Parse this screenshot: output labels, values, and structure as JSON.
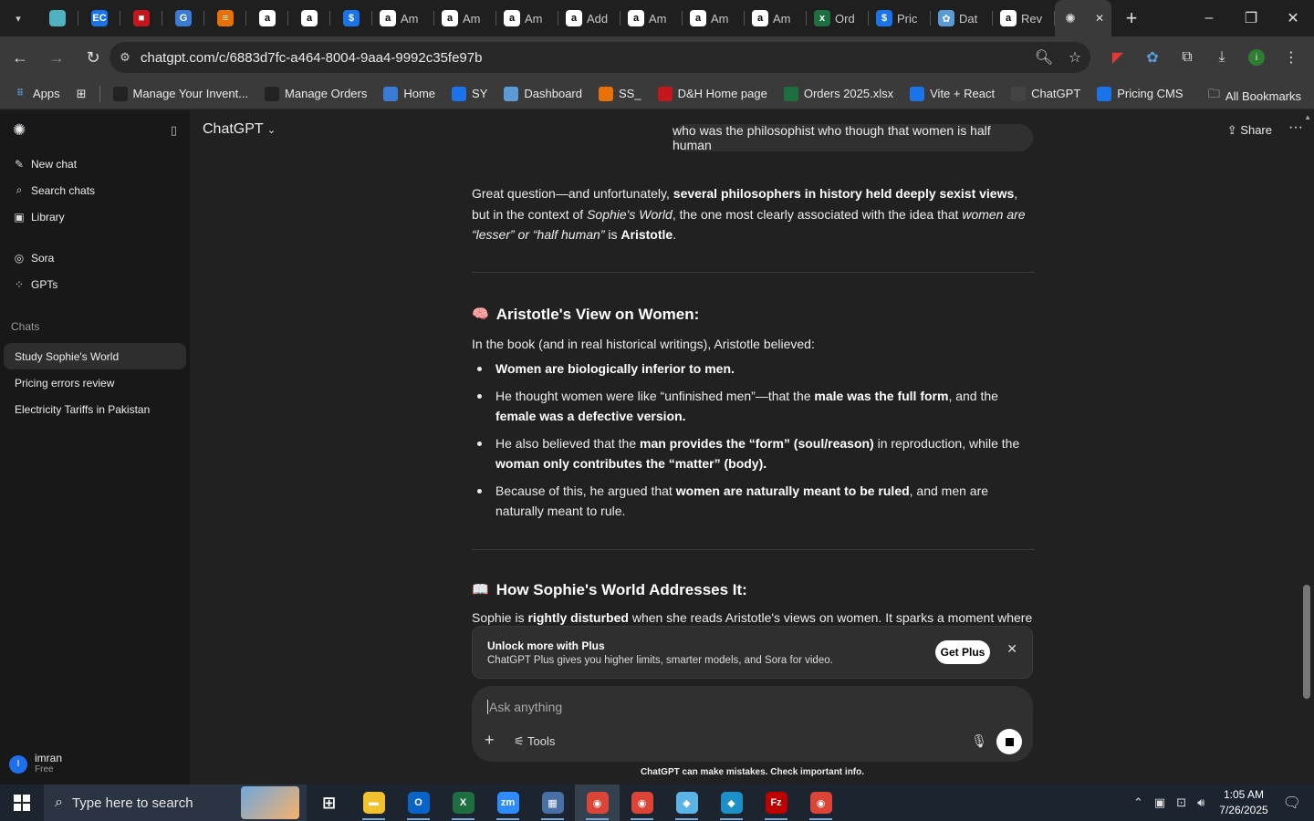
{
  "browser": {
    "tabs": [
      {
        "title": "",
        "icon": "teal-logo-icon",
        "color": "#4fb3bf"
      },
      {
        "title": "",
        "icon": "ec-logo-icon",
        "color": "#1a73e8",
        "glyph": "EC"
      },
      {
        "title": "",
        "icon": "red-app-icon",
        "color": "#c4161c",
        "glyph": "■"
      },
      {
        "title": "",
        "icon": "blue-g-icon",
        "color": "#3a7bd5",
        "glyph": "G"
      },
      {
        "title": "",
        "icon": "orange-stack-icon",
        "color": "#e8710a",
        "glyph": "≡"
      },
      {
        "title": "",
        "icon": "amazon-icon",
        "color": "#ffffff",
        "glyph": "a"
      },
      {
        "title": "",
        "icon": "amazon-icon",
        "color": "#ffffff",
        "glyph": "a"
      },
      {
        "title": "",
        "icon": "dollar-icon",
        "color": "#1a73e8",
        "glyph": "$"
      },
      {
        "title": "Am",
        "icon": "amazon-icon",
        "color": "#ffffff",
        "glyph": "a"
      },
      {
        "title": "Am",
        "icon": "amazon-icon",
        "color": "#ffffff",
        "glyph": "a"
      },
      {
        "title": "Am",
        "icon": "amazon-icon",
        "color": "#ffffff",
        "glyph": "a"
      },
      {
        "title": "Add",
        "icon": "amazon-icon",
        "color": "#ffffff",
        "glyph": "a"
      },
      {
        "title": "Am",
        "icon": "amazon-icon",
        "color": "#ffffff",
        "glyph": "a"
      },
      {
        "title": "Am",
        "icon": "amazon-icon",
        "color": "#ffffff",
        "glyph": "a"
      },
      {
        "title": "Am",
        "icon": "amazon-circle-icon",
        "color": "#ffffff",
        "glyph": "a"
      },
      {
        "title": "Ord",
        "icon": "excel-icon",
        "color": "#1d6f42",
        "glyph": "x"
      },
      {
        "title": "Pric",
        "icon": "dollar-icon",
        "color": "#1a73e8",
        "glyph": "$"
      },
      {
        "title": "Dat",
        "icon": "dashboard-icon",
        "color": "#5b9bd5",
        "glyph": "✿"
      },
      {
        "title": "Rev",
        "icon": "amazon-icon",
        "color": "#ffffff",
        "glyph": "a"
      }
    ],
    "active_tab_icon": "chatgpt-icon",
    "url": "chatgpt.com/c/6883d7fc-a464-8004-9aa4-9992c35fe97b",
    "bookmarks": [
      {
        "label": "Manage Your Invent...",
        "icon": "amazon-icon",
        "color": "#222"
      },
      {
        "label": "Manage Orders",
        "icon": "amazon-icon",
        "color": "#222"
      },
      {
        "label": "Home",
        "icon": "blue-g-icon",
        "color": "#3a7bd5"
      },
      {
        "label": "SY",
        "icon": "ec-logo-icon",
        "color": "#1a73e8"
      },
      {
        "label": "Dashboard",
        "icon": "dashboard-icon",
        "color": "#5b9bd5"
      },
      {
        "label": "SS_",
        "icon": "orange-stack-icon",
        "color": "#e8710a"
      },
      {
        "label": "D&H Home page",
        "icon": "red-app-icon",
        "color": "#c4161c"
      },
      {
        "label": "Orders 2025.xlsx",
        "icon": "excel-icon",
        "color": "#1d6f42"
      },
      {
        "label": "Vite + React",
        "icon": "dollar-icon",
        "color": "#1a73e8"
      },
      {
        "label": "ChatGPT",
        "icon": "chatgpt-icon",
        "color": "#444"
      },
      {
        "label": "Pricing CMS",
        "icon": "dollar-icon",
        "color": "#1a73e8"
      }
    ],
    "apps_label": "Apps",
    "all_bookmarks_label": "All Bookmarks"
  },
  "sidebar": {
    "new_chat": "New chat",
    "search_chats": "Search chats",
    "library": "Library",
    "sora": "Sora",
    "gpts": "GPTs",
    "chats_header": "Chats",
    "chats": [
      "Study Sophie's World",
      "Pricing errors review",
      "Electricity Tariffs in Pakistan"
    ],
    "user": {
      "initial": "I",
      "name": "imran",
      "plan": "Free"
    }
  },
  "header": {
    "model": "ChatGPT",
    "share": "Share"
  },
  "conversation": {
    "user_message": "who was the philosophist who though that women is half human",
    "heading1": "Aristotle's View on Women:",
    "heading1_emoji": "🧠",
    "intro2": "In the book (and in real historical writings), Aristotle believed:",
    "heading2": "How Sophie's World Addresses It:",
    "heading2_emoji": "📖"
  },
  "promo": {
    "title": "Unlock more with Plus",
    "desc": "ChatGPT Plus gives you higher limits, smarter models, and Sora for video.",
    "button": "Get Plus"
  },
  "composer": {
    "placeholder": "Ask anything",
    "tools": "Tools"
  },
  "disclaimer": "ChatGPT can make mistakes. Check important info.",
  "taskbar": {
    "search_placeholder": "Type here to search",
    "time": "1:05 AM",
    "date": "7/26/2025",
    "apps": [
      {
        "name": "task-view",
        "color": "transparent",
        "glyph": "⊞"
      },
      {
        "name": "file-explorer",
        "color": "#f2c12e",
        "glyph": "▬"
      },
      {
        "name": "outlook",
        "color": "#0a64c8",
        "glyph": "O"
      },
      {
        "name": "excel",
        "color": "#1d6f42",
        "glyph": "X"
      },
      {
        "name": "zoom",
        "color": "#2d8cff",
        "glyph": "zm"
      },
      {
        "name": "calculator",
        "color": "#4a6fa5",
        "glyph": "▦"
      },
      {
        "name": "chrome",
        "color": "#db4437",
        "glyph": "◉"
      },
      {
        "name": "chrome-profile-2",
        "color": "#db4437",
        "glyph": "◉"
      },
      {
        "name": "notes-app",
        "color": "#5bb4e5",
        "glyph": "◆"
      },
      {
        "name": "vpn-app",
        "color": "#1e90c8",
        "glyph": "◆"
      },
      {
        "name": "filezilla",
        "color": "#bf0000",
        "glyph": "Fz"
      },
      {
        "name": "chrome-profile-3",
        "color": "#db4437",
        "glyph": "◉"
      }
    ]
  }
}
